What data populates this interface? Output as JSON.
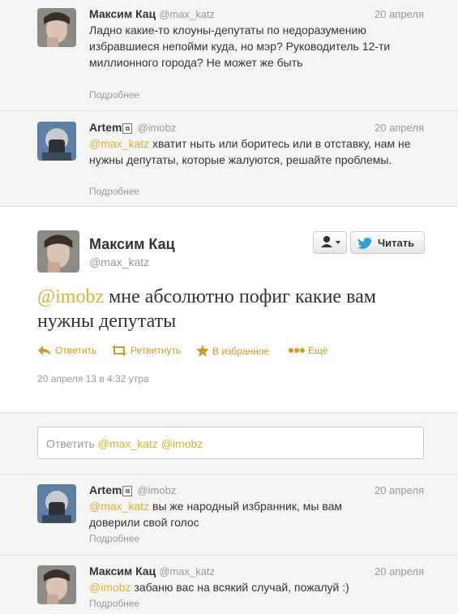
{
  "tweets_above": [
    {
      "name": "Максим Кац",
      "handle": "@max_katz",
      "date": "20 апреля",
      "text": "Ладно какие-то клоуны-депутаты по недоразумению избравшиеся непойми куда, но мэр? Руководитель 12-ти миллионного города? Не может же быть",
      "more": "Подробнее"
    },
    {
      "name": "Artem",
      "handle": "@imobz",
      "date": "20 апреля",
      "mention": "@max_katz",
      "text": " хватит ныть или боритесь или в отставку, нам не нужны депутаты, которые жалуются, решайте проблемы.",
      "more": "Подробнее"
    }
  ],
  "main": {
    "name": "Максим Кац",
    "handle": "@max_katz",
    "follow_label": "Читать",
    "mention": "@imobz",
    "text": " мне абсолютно пофиг какие вам нужны депутаты",
    "actions": {
      "reply": "Ответить",
      "retweet": "Ретвитнуть",
      "favorite": "В избранное",
      "more": "Ещё"
    },
    "timestamp": "20 апреля 13 в 4:32 утра"
  },
  "reply_box": {
    "placeholder_prefix": "Ответить ",
    "mentions": "@max_katz @imobz"
  },
  "replies": [
    {
      "name": "Artem",
      "handle": "@imobz",
      "date": "20 апреля",
      "mention": "@max_katz",
      "text": " вы же народный избранник, мы вам доверили свой голос",
      "more": "Подробнее"
    },
    {
      "name": "Максим Кац",
      "handle": "@max_katz",
      "date": "20 апреля",
      "mention": "@imobz",
      "text": " забаню вас на всякий случай, пожалуй :)",
      "more": "Подробнее"
    }
  ],
  "colors": {
    "accent": "#dbb32e",
    "link": "#cc9b20",
    "muted": "#999999"
  }
}
